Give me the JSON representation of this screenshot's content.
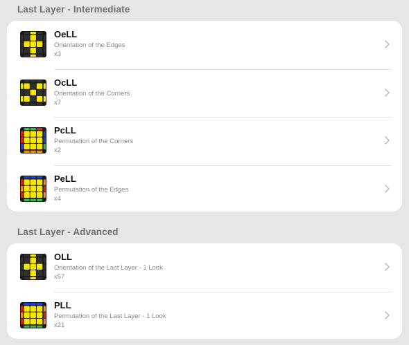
{
  "sections": [
    {
      "header": "Last Layer - Intermediate",
      "items": [
        {
          "title": "OeLL",
          "subtitle": "Orientation of the Edges",
          "count": "x3",
          "cube_icon": "oell-cube-icon"
        },
        {
          "title": "OcLL",
          "subtitle": "Orientation of the Corners",
          "count": "x7",
          "cube_icon": "ocll-cube-icon"
        },
        {
          "title": "PcLL",
          "subtitle": "Permutation of the Corners",
          "count": "x2",
          "cube_icon": "pcll-cube-icon"
        },
        {
          "title": "PeLL",
          "subtitle": "Permutation of the Edges",
          "count": "x4",
          "cube_icon": "pell-cube-icon"
        }
      ]
    },
    {
      "header": "Last Layer - Advanced",
      "items": [
        {
          "title": "OLL",
          "subtitle": "Orientation of the Last Layer - 1 Look",
          "count": "x57",
          "cube_icon": "oll-cube-icon"
        },
        {
          "title": "PLL",
          "subtitle": "Permutation of the Last Layer - 1 Look",
          "count": "x21",
          "cube_icon": "pll-cube-icon"
        }
      ]
    }
  ],
  "colors": {
    "background": "#e6e6e6",
    "card": "#ffffff",
    "yellow": "#f7e600",
    "dark": "#2f2f2f",
    "red": "#e0201b",
    "blue": "#1f3fd0",
    "green": "#31b84b",
    "orange": "#f08a1c",
    "chevron": "#b8b8b8"
  }
}
